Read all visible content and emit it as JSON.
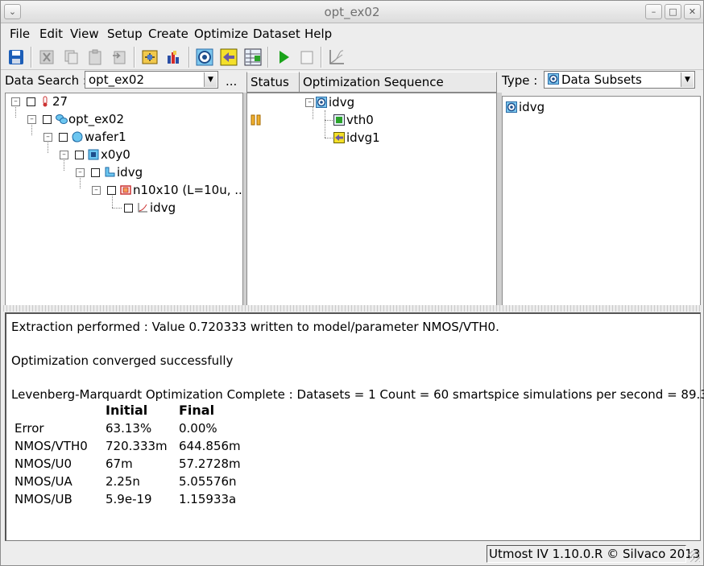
{
  "window": {
    "title": "opt_ex02"
  },
  "menu": [
    "File",
    "Edit",
    "View",
    "Setup",
    "Create",
    "Optimize",
    "Dataset",
    "Help"
  ],
  "toolbar": [
    "save-icon",
    "cut-icon",
    "copy-icon",
    "paste-icon",
    "delete-icon",
    "extract-icon",
    "bars-icon",
    "target-icon",
    "yellow-arrow-icon",
    "table-icon",
    "run-icon",
    "stop-icon",
    "plot-icon"
  ],
  "data_search": {
    "label": "Data Search :",
    "value": "opt_ex02",
    "more": "..."
  },
  "tree": [
    {
      "label": "27"
    },
    {
      "label": "opt_ex02"
    },
    {
      "label": "wafer1"
    },
    {
      "label": "x0y0"
    },
    {
      "label": "idvg"
    },
    {
      "label": "n10x10 (L=10u, ..."
    },
    {
      "label": "idvg"
    }
  ],
  "sequence": {
    "col_status": "Status",
    "col_sequence": "Optimization Sequence",
    "items": [
      {
        "label": "idvg",
        "status": ""
      },
      {
        "label": "vth0",
        "status": "paused"
      },
      {
        "label": "idvg1",
        "status": ""
      }
    ]
  },
  "type_panel": {
    "label": "Type :",
    "value": "Data Subsets",
    "items": [
      "idvg"
    ]
  },
  "output": {
    "line1": "Extraction performed : Value 0.720333 written to model/parameter NMOS/VTH0.",
    "line2": "Optimization converged successfully",
    "line3": "Levenberg-Marquardt Optimization Complete : Datasets = 1  Count = 60  smartspice simulations per second = 89.3",
    "table": {
      "headers": [
        "",
        "Initial",
        "Final"
      ],
      "rows": [
        [
          "Error",
          "63.13%",
          "0.00%"
        ],
        [
          "NMOS/VTH0",
          "720.333m",
          "644.856m"
        ],
        [
          "NMOS/U0",
          "67m",
          "57.2728m"
        ],
        [
          "NMOS/UA",
          "2.25n",
          "5.05576n"
        ],
        [
          "NMOS/UB",
          "5.9e-19",
          "1.15933a"
        ]
      ]
    }
  },
  "status": {
    "text": "Utmost IV 1.10.0.R © Silvaco 2013"
  },
  "colors": {
    "accent_blue": "#1f6fd1",
    "status_orange": "#e0a020",
    "run_green": "#1aa31a"
  }
}
